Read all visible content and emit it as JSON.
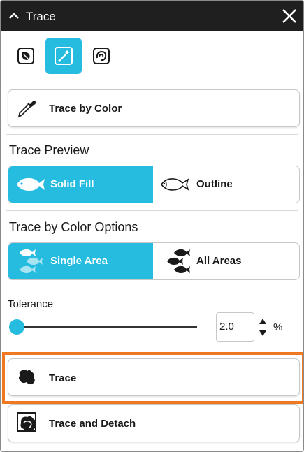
{
  "window": {
    "title": "Trace"
  },
  "tools": [
    {
      "icon": "trace-by-image-icon",
      "active": false
    },
    {
      "icon": "trace-by-color-icon",
      "active": true
    },
    {
      "icon": "trace-by-outline-icon",
      "active": false
    }
  ],
  "mode_button": {
    "label": "Trace by Color",
    "icon": "eyedropper-icon"
  },
  "preview": {
    "heading": "Trace Preview",
    "options": [
      {
        "label": "Solid Fill",
        "icon": "solid-fish-icon",
        "selected": true
      },
      {
        "label": "Outline",
        "icon": "outline-fish-icon",
        "selected": false
      }
    ]
  },
  "color_options": {
    "heading": "Trace by Color Options",
    "options": [
      {
        "label": "Single Area",
        "icon": "single-area-fish-icon",
        "selected": true
      },
      {
        "label": "All Areas",
        "icon": "all-areas-fish-icon",
        "selected": false
      }
    ]
  },
  "tolerance": {
    "label": "Tolerance",
    "value": "2.0",
    "unit": "%",
    "slider_level": 0.0
  },
  "actions": {
    "trace": {
      "label": "Trace",
      "icon": "trace-shape-icon",
      "highlighted": true
    },
    "trace_detach": {
      "label": "Trace and Detach",
      "icon": "trace-detach-icon"
    }
  },
  "colors": {
    "accent": "#25bcdf",
    "titlebar": "#1f1f1f",
    "highlight": "#f07820"
  }
}
